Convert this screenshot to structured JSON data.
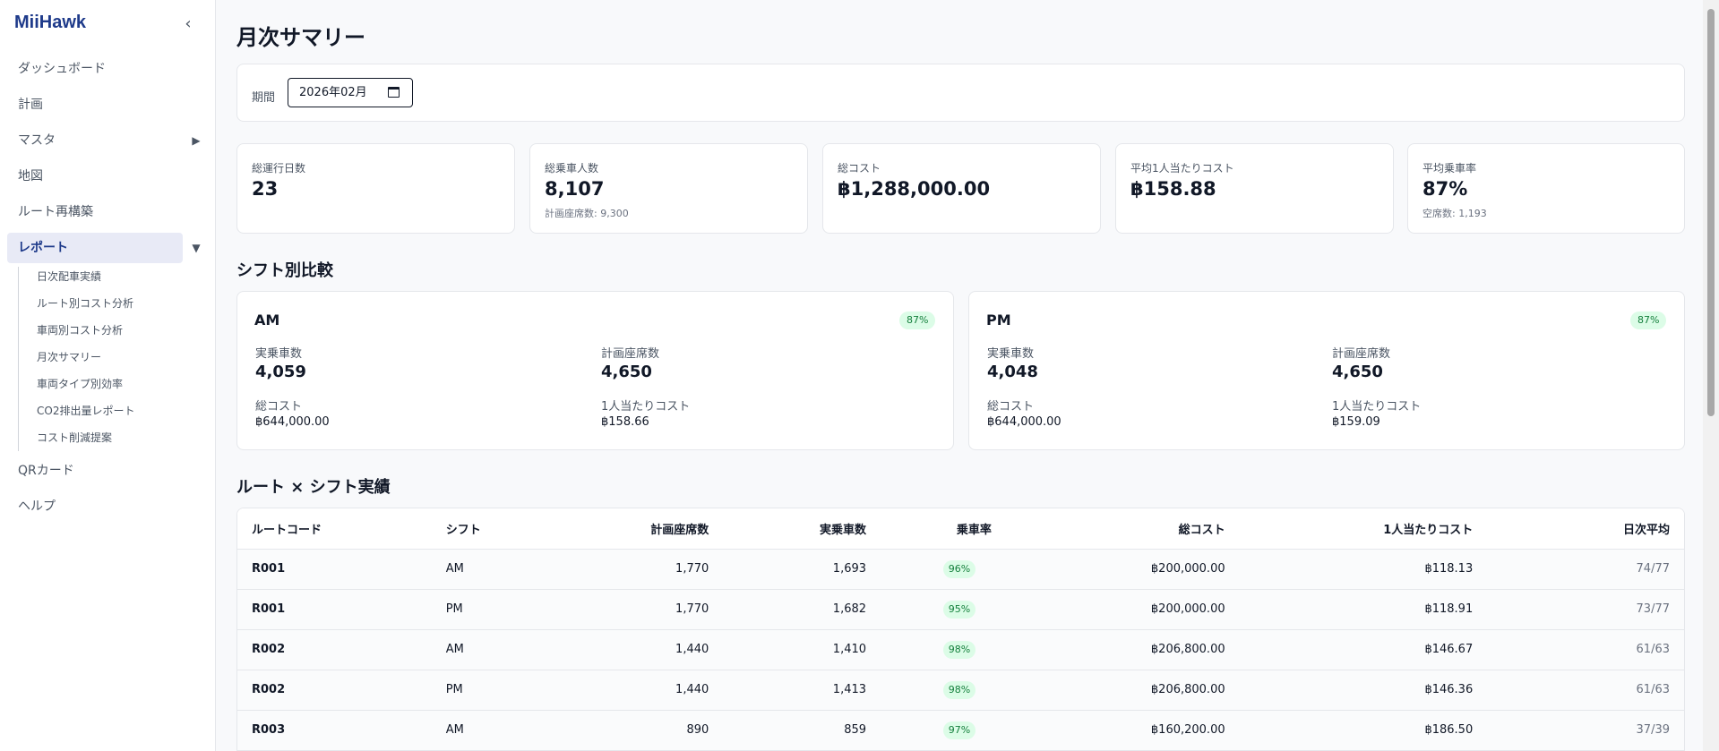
{
  "sidebar": {
    "brand": "MiiHawk",
    "collapse_icon": "chevron-left-icon",
    "items": [
      {
        "label": "ダッシュボード"
      },
      {
        "label": "計画"
      },
      {
        "label": "マスタ",
        "expand": "▶"
      },
      {
        "label": "地図"
      },
      {
        "label": "ルート再構築"
      },
      {
        "label": "レポート",
        "expand": "▼"
      },
      {
        "label": "QRカード"
      },
      {
        "label": "ヘルプ"
      }
    ],
    "report_sub_items": [
      {
        "label": "日次配車実績"
      },
      {
        "label": "ルート別コスト分析"
      },
      {
        "label": "車両別コスト分析"
      },
      {
        "label": "月次サマリー"
      },
      {
        "label": "車両タイプ別効率"
      },
      {
        "label": "CO2排出量レポート"
      },
      {
        "label": "コスト削減提案"
      }
    ]
  },
  "header": {
    "title": "月次サマリー",
    "period_label": "期間",
    "period_value": "2026年02月"
  },
  "kpis": [
    {
      "label": "総運行日数",
      "value": "23",
      "sub": ""
    },
    {
      "label": "総乗車人数",
      "value": "8,107",
      "sub": "計画座席数: 9,300"
    },
    {
      "label": "総コスト",
      "value": "฿1,288,000.00",
      "sub": ""
    },
    {
      "label": "平均1人当たりコスト",
      "value": "฿158.88",
      "sub": ""
    },
    {
      "label": "平均乗車率",
      "value": "87%",
      "sub": "空席数: 1,193"
    }
  ],
  "shift_section": {
    "title": "シフト別比較",
    "shifts": [
      {
        "name": "AM",
        "rate": "87%",
        "actual_label": "実乗車数",
        "actual": "4,059",
        "planned_label": "計画座席数",
        "planned": "4,650",
        "cost_label": "総コスト",
        "cost": "฿644,000.00",
        "per_label": "1人当たりコスト",
        "per": "฿158.66"
      },
      {
        "name": "PM",
        "rate": "87%",
        "actual_label": "実乗車数",
        "actual": "4,048",
        "planned_label": "計画座席数",
        "planned": "4,650",
        "cost_label": "総コスト",
        "cost": "฿644,000.00",
        "per_label": "1人当たりコスト",
        "per": "฿159.09"
      }
    ]
  },
  "route_section": {
    "title": "ルート × シフト実績",
    "columns": [
      "ルートコード",
      "シフト",
      "計画座席数",
      "実乗車数",
      "乗車率",
      "総コスト",
      "1人当たりコスト",
      "日次平均"
    ],
    "rows": [
      [
        "R001",
        "AM",
        "1,770",
        "1,693",
        "96%",
        "฿200,000.00",
        "฿118.13",
        "74/77"
      ],
      [
        "R001",
        "PM",
        "1,770",
        "1,682",
        "95%",
        "฿200,000.00",
        "฿118.91",
        "73/77"
      ],
      [
        "R002",
        "AM",
        "1,440",
        "1,410",
        "98%",
        "฿206,800.00",
        "฿146.67",
        "61/63"
      ],
      [
        "R002",
        "PM",
        "1,440",
        "1,413",
        "98%",
        "฿206,800.00",
        "฿146.36",
        "61/63"
      ],
      [
        "R003",
        "AM",
        "890",
        "859",
        "97%",
        "฿160,200.00",
        "฿186.50",
        "37/39"
      ]
    ]
  }
}
